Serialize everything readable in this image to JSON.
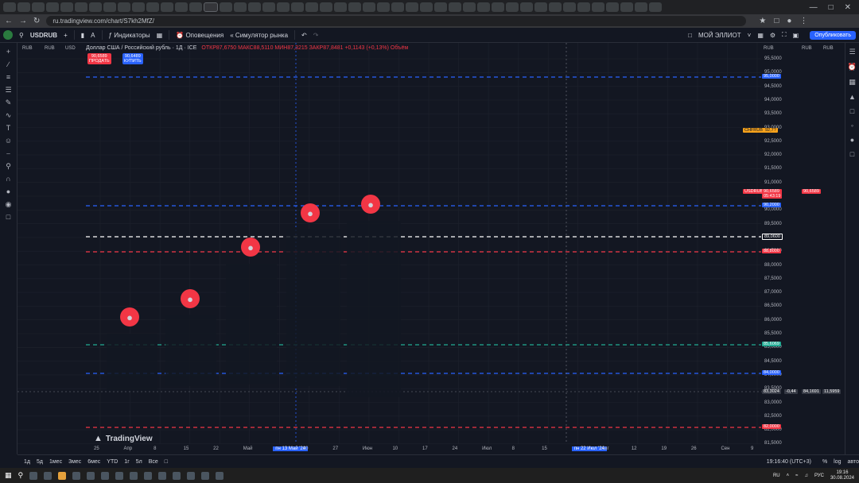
{
  "browser": {
    "url": "ru.tradingview.com/chart/S7kh2MfZ/"
  },
  "toolbar": {
    "symbol": "USDRUB",
    "indicators_label": "Индикаторы",
    "alerts_label": "Оповещения",
    "replay_label": "Симулятор рынка",
    "layout_name": "МОЙ ЭЛЛИОТ",
    "publish_label": "Опубликовать"
  },
  "legend": {
    "title": "Доллар США / Российский рубль · 1Д · ICE",
    "ohlc": "ОТКР87,6750  МАКС88,5110  МИН87,3215  ЗАКР87,8481  +0,1143 (+0,13%)  Объём",
    "sell_price": "90,6589",
    "sell_label": "ПРОДАТЬ",
    "buy_price": "90,6489",
    "buy_label": "КУПИТЬ"
  },
  "scale_labels": {
    "left_a": "RUB",
    "left_b": "RUB",
    "left_c": "USD",
    "right_a": "RUB",
    "right_b": "RUB",
    "right_c": "RUB"
  },
  "price_axis": [
    "95,5000",
    "95,0000",
    "94,5000",
    "94,0000",
    "93,5000",
    "93,0000",
    "92,5000",
    "92,0000",
    "91,5000",
    "91,0000",
    "90,5000",
    "90,0000",
    "89,5000",
    "89,0000",
    "88,5000",
    "88,0000",
    "87,5000",
    "87,0000",
    "86,5000",
    "86,0000",
    "85,5000",
    "85,0000",
    "84,5000",
    "84,0000",
    "83,5000",
    "83,0000",
    "82,5000",
    "82,0000",
    "81,5000"
  ],
  "price_labels": {
    "hl_95": "95,0000",
    "chf": "CHFRUB",
    "chf_val": "92,7?",
    "usd": "USDRUB",
    "usd_time": "05:43:19",
    "usd_val": "90,6589",
    "hl_90_2": "90,2000",
    "hl_89_06": "89,0600",
    "hl_88_8": "88,8000",
    "hl_85_6": "85,6069",
    "hl_84": "84,0000",
    "cross": "83,3024",
    "cross_chg": "-0,44",
    "cross_r1": "84,1691",
    "cross_r2": "11,5959",
    "hl_82": "82,0000"
  },
  "time_axis": [
    "25",
    "Апр",
    "8",
    "15",
    "22",
    "Май",
    "пн 13 Май '24",
    "20",
    "27",
    "Июн",
    "10",
    "17",
    "24",
    "Июл",
    "8",
    "15",
    "пн 22 Июл '24",
    "Авг",
    "12",
    "19",
    "26",
    "Сен",
    "9"
  ],
  "tradingview_brand": "TradingView",
  "timeframes": [
    "1д",
    "5д",
    "1мес",
    "3мес",
    "6мес",
    "YTD",
    "1г",
    "5л",
    "Все"
  ],
  "clock": "19:16:40 (UTC+3)",
  "taskbar": {
    "lang": "RU",
    "lang2": "РУС",
    "time": "19:16",
    "date": "30.08.2024"
  },
  "colors": {
    "bg": "#131722",
    "up": "#22ab94",
    "down": "#f23645",
    "green_line": "#7ed957",
    "orange_line": "#f7a21b",
    "blue_dash": "#2962ff",
    "red_dash": "#f23645",
    "white_dash": "#ffffff"
  }
}
